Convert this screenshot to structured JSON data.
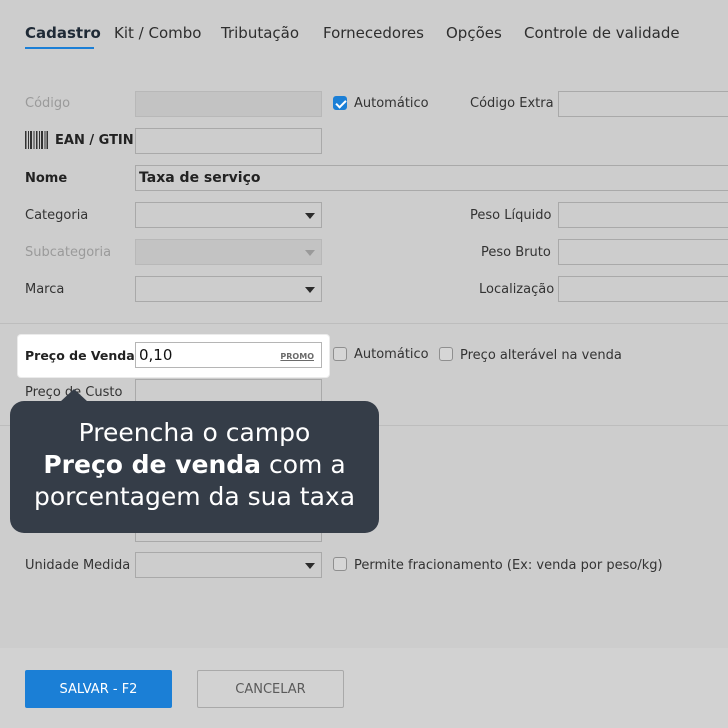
{
  "tabs": [
    "Cadastro",
    "Kit / Combo",
    "Tributação",
    "Fornecedores",
    "Opções",
    "Controle de validade"
  ],
  "form": {
    "codigo_label": "Código",
    "automatico_label": "Automático",
    "codigo_extra_label": "Código Extra",
    "ean_label": "EAN / GTIN",
    "nome_label": "Nome",
    "nome_value": "Taxa de serviço",
    "categoria_label": "Categoria",
    "peso_liquido_label": "Peso Líquido",
    "subcategoria_label": "Subcategoria",
    "peso_bruto_label": "Peso Bruto",
    "marca_label": "Marca",
    "localizacao_label": "Localização",
    "preco_venda_label": "Preço de Venda",
    "preco_venda_value": "0,10",
    "promo_label": "PROMO",
    "automatico2_label": "Automático",
    "preco_alteravel_label": "Preço alterável na venda",
    "preco_custo_label": "Preço de Custo",
    "unidade_medida_label": "Unidade Medida",
    "permite_fracionamento_label": "Permite fracionamento (Ex: venda por peso/kg)",
    "automatico_checked": true,
    "automatico2_checked": false,
    "preco_alteravel_checked": false,
    "permite_fracionamento_checked": false
  },
  "tooltip": {
    "line1": "Preencha o campo",
    "line2_bold": "Preço de venda",
    "line2_rest": " com a",
    "line3": "porcentagem da sua taxa"
  },
  "buttons": {
    "save": "SALVAR - F2",
    "cancel": "CANCELAR"
  },
  "colors": {
    "accent": "#1b7fd6",
    "tooltip_bg": "#353d48",
    "overlay_bg": "#cdcdcd"
  }
}
